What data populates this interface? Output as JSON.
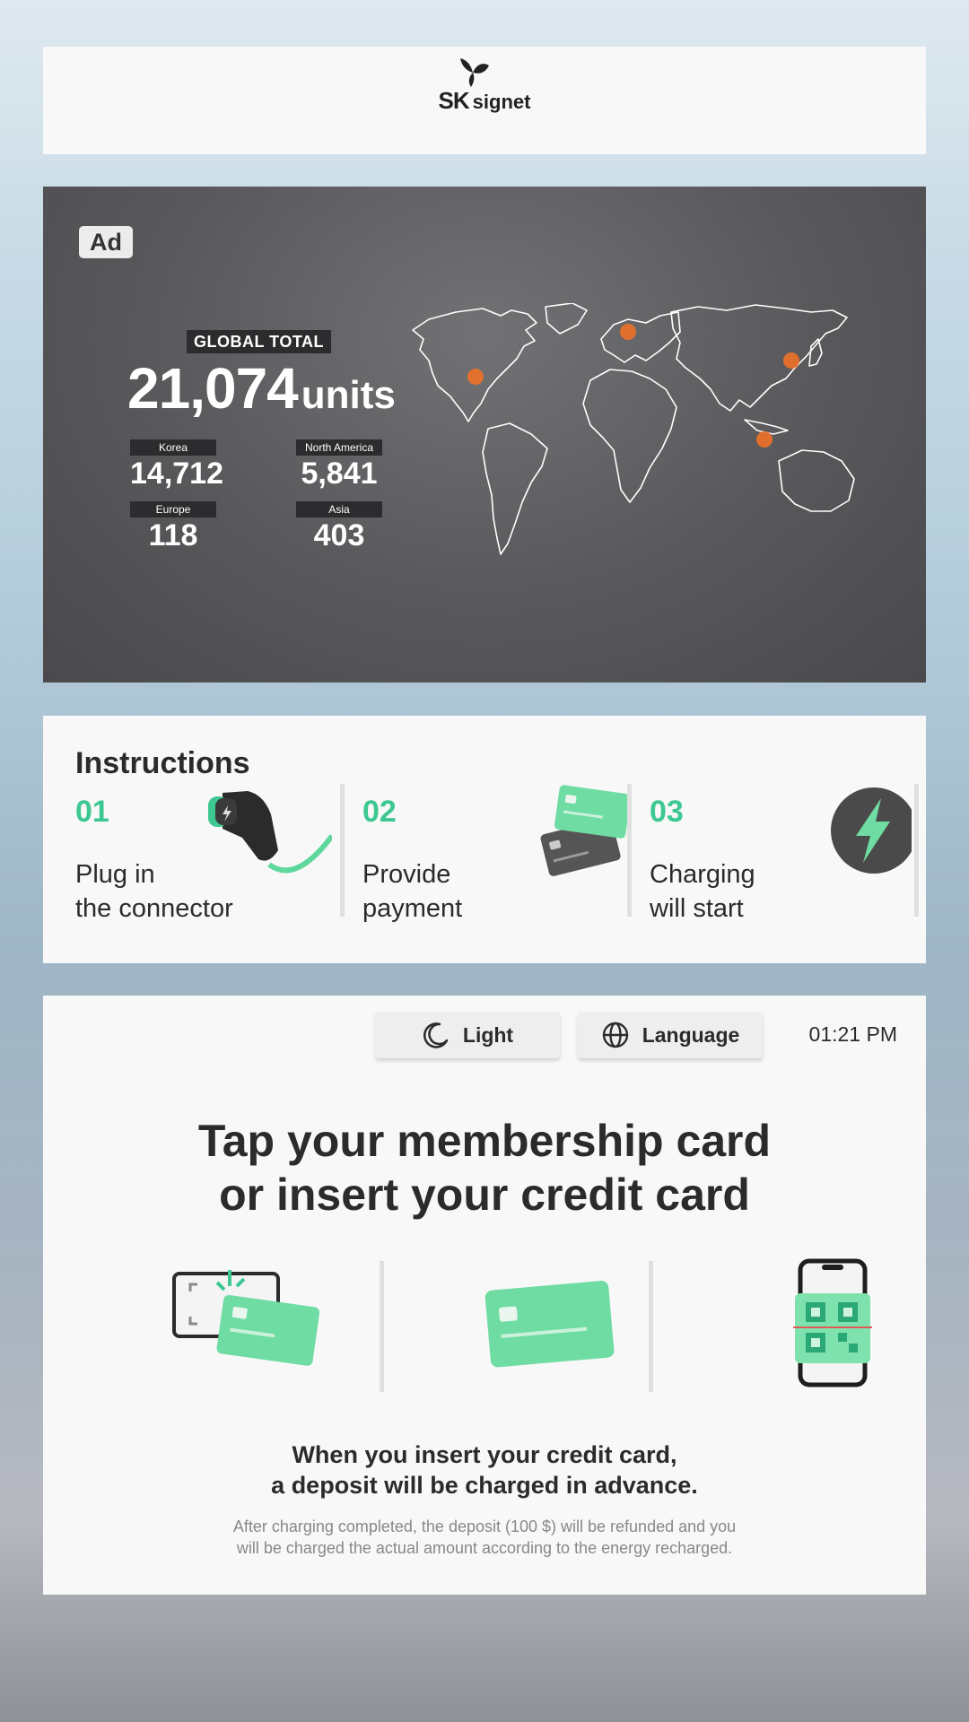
{
  "header": {
    "logo_sk": "SK",
    "logo_signet": "signet"
  },
  "ad": {
    "badge": "Ad",
    "global_label": "GLOBAL TOTAL",
    "global_value": "21,074",
    "global_unit": "units",
    "regions": [
      {
        "label": "Korea",
        "value": "14,712"
      },
      {
        "label": "North America",
        "value": "5,841"
      },
      {
        "label": "Europe",
        "value": "118"
      },
      {
        "label": "Asia",
        "value": "403"
      }
    ],
    "marker_color": "#e8702a"
  },
  "instructions": {
    "title": "Instructions",
    "steps": [
      {
        "num": "01",
        "line1": "Plug in",
        "line2": "the connector",
        "icon": "connector-icon"
      },
      {
        "num": "02",
        "line1": "Provide",
        "line2": "payment",
        "icon": "cards-icon"
      },
      {
        "num": "03",
        "line1": "Charging",
        "line2": "will start",
        "icon": "lightning-icon"
      }
    ]
  },
  "controls": {
    "theme_label": "Light",
    "language_label": "Language",
    "time": "01:21 PM"
  },
  "main": {
    "headline_line1": "Tap your membership card",
    "headline_line2": "or insert your credit card",
    "note_line1": "When you insert your credit card,",
    "note_line2": "a deposit will be charged in advance.",
    "small_line1": "After charging completed, the deposit (100 $) will be refunded and you",
    "small_line2": "will be charged the actual amount according to the energy recharged."
  },
  "colors": {
    "accent": "#3dc791",
    "panel": "#f8f8f8",
    "ad_bg": "#58585b"
  }
}
